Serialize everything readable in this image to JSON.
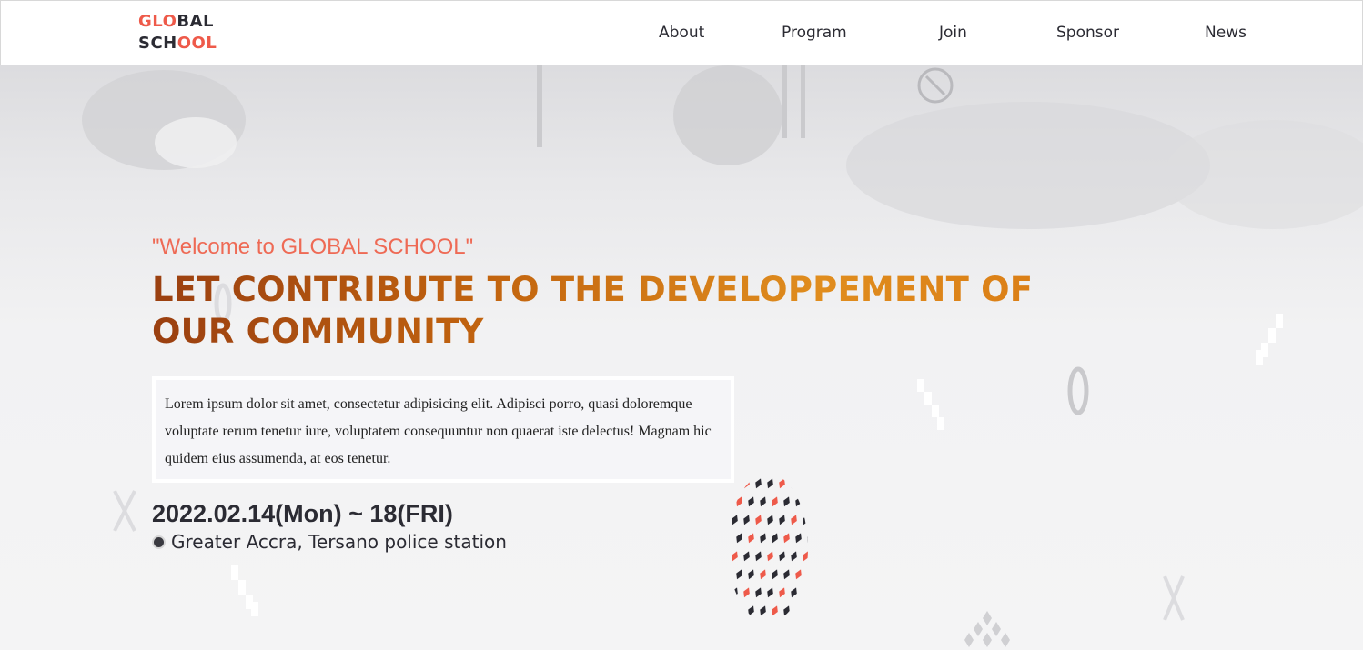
{
  "header": {
    "logo": {
      "line1_red": "GLO",
      "line1_dark": "BAL",
      "line2_dark": "SCH",
      "line2_red": "OOL"
    },
    "nav": [
      "About",
      "Program",
      "Join",
      "Sponsor",
      "News"
    ]
  },
  "hero": {
    "welcome": "\"Welcome to GLOBAL SCHOOL\"",
    "headline_line1": "LET CONTRIBUTE TO THE DEVELOPPEMENT OF",
    "headline_line2": "OUR COMMUNITY",
    "description": "Lorem ipsum dolor sit amet, consectetur adipisicing elit. Adipisci porro, quasi doloremque voluptate rerum tenetur iure, voluptatem consequuntur non quaerat iste delectus! Magnam hic quidem eius assumenda, at eos tenetur.",
    "date": "2022.02.14(Mon) ~ 18(FRI)",
    "location": "Greater Accra, Tersano police station"
  },
  "colors": {
    "accent_red": "#ee5a4a",
    "dark": "#2b2b33",
    "headline_orange": "#c2640f"
  },
  "icons": {
    "location": "location-pin-icon"
  }
}
